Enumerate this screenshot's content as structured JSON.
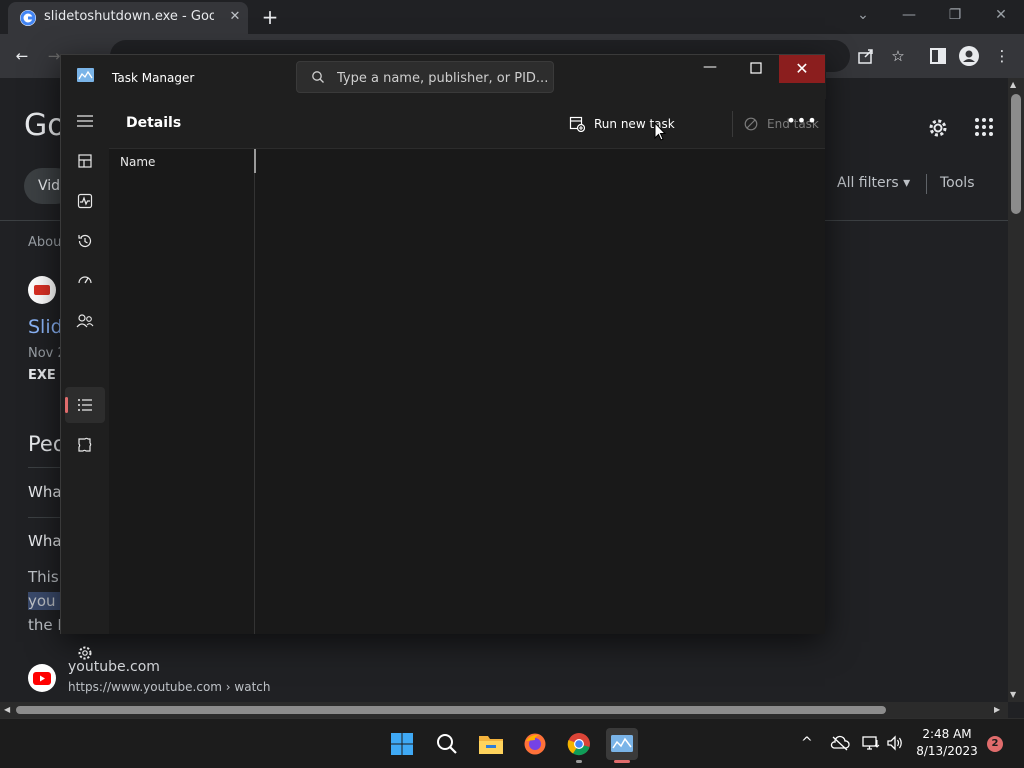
{
  "browser": {
    "tab_title": "slidetoshutdown.exe - Google Se",
    "tab_close": "✕",
    "new_tab": "+",
    "window_min": "—",
    "window_restore": "❐",
    "window_close": "✕"
  },
  "page": {
    "logo_partial": "Go",
    "videos_chip": "Vid",
    "all_filters": "All filters ▾",
    "tools": "Tools",
    "about": "Abou",
    "result_title": "Slid",
    "result_date": "Nov 2",
    "result_snippet": "EXE f",
    "people_also_ask": "Peo",
    "paa_q1": "Wha",
    "paa_q2": "Wha",
    "snippet_line1": "This",
    "snippet_line2": "you i",
    "snippet_line3": "the F",
    "youtube_site": "youtube.com",
    "youtube_url": "https://www.youtube.com › watch"
  },
  "task_manager": {
    "title": "Task Manager",
    "search_placeholder": "Type a name, publisher, or PID...",
    "page_heading": "Details",
    "run_new_task": "Run new task",
    "end_task": "End task",
    "more": "•••",
    "column_name": "Name",
    "nav_items": [
      "hamburger-menu-icon",
      "processes-icon",
      "performance-icon",
      "app-history-icon",
      "startup-apps-icon",
      "users-icon",
      "details-icon",
      "services-icon"
    ],
    "active_nav": "details-icon",
    "accent_color": "#e06c6c",
    "close_color": "#8b1e1e"
  },
  "taskbar": {
    "time": "2:48 AM",
    "date": "8/13/2023",
    "notification_count": "2",
    "apps": [
      "windows-start-icon",
      "search-icon",
      "file-explorer-icon",
      "firefox-icon",
      "chrome-icon",
      "task-manager-icon"
    ]
  }
}
